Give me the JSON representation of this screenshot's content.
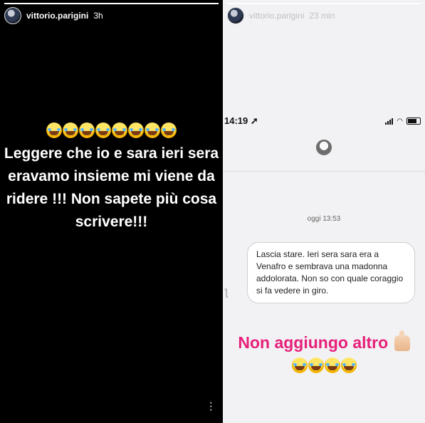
{
  "left_story": {
    "username": "vittorio.parigini",
    "time_ago": "3h",
    "emoji_count": 8,
    "text": "Leggere che io e sara ieri sera eravamo insieme mi viene da ridere !!! Non sapete più cosa scrivere!!!",
    "emoji_icon": "face-with-tears-of-joy-icon",
    "more_icon": "vertical-dots-icon"
  },
  "right_story": {
    "username": "vittorio.parigini",
    "time_ago": "23 min",
    "screenshot": {
      "clock": "14:19",
      "date_label": "oggi 13:53",
      "message": "Lascia stare. Ieri sera sara era a Venafro e sembrava una madonna addolorata. Non so con quale coraggio si fa vedere in giro."
    },
    "caption": "Non aggiungo altro",
    "caption_color": "#e6207a",
    "emoji_count": 4
  }
}
